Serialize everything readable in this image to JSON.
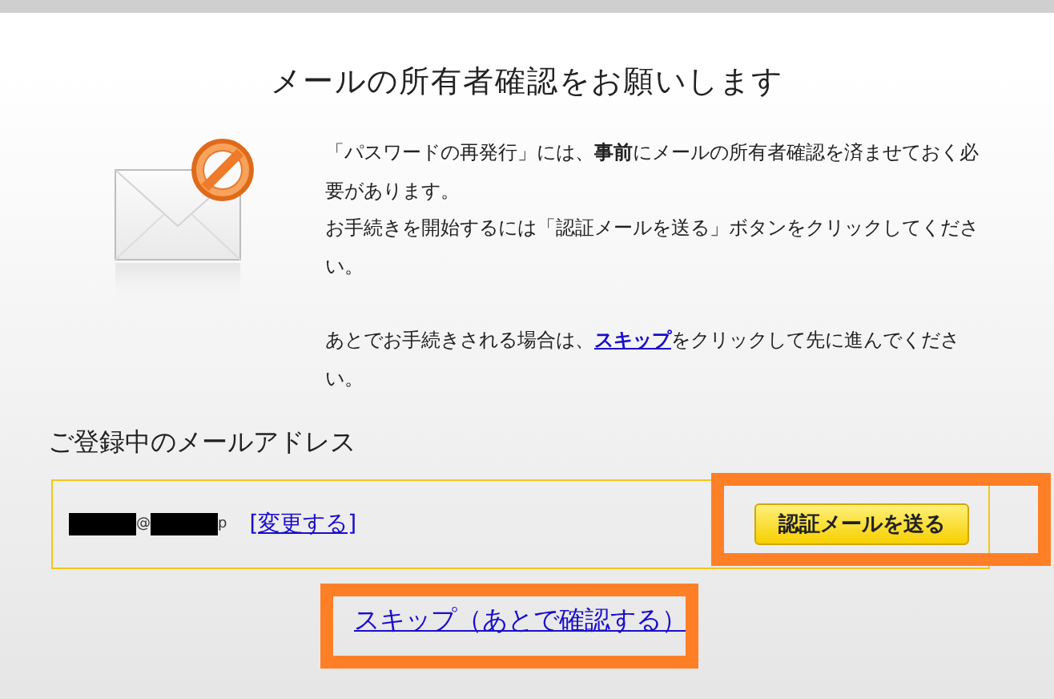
{
  "title": "メールの所有者確認をお願いします",
  "message": {
    "lines": [
      "「パスワードの再発行」には、**事前**にメールの所有者確認を済ませておく必要があります。",
      "お手続きを開始するには「認証メールを送る」ボタンをクリックしてください。"
    ],
    "later": {
      "before": "あとでお手続きされる場合は、",
      "link": "スキップ",
      "after": "をクリックして先に進んでください。"
    }
  },
  "address_section": {
    "heading": "ご登録中のメールアドレス",
    "email_parts": [
      {
        "kind": "redacted"
      },
      {
        "kind": "text",
        "text": "@"
      },
      {
        "kind": "redacted"
      },
      {
        "kind": "text",
        "text": "p"
      }
    ],
    "change_link": "[変更する]",
    "send_button": "認証メールを送る"
  },
  "skip_link": "スキップ（あとで確認する）"
}
